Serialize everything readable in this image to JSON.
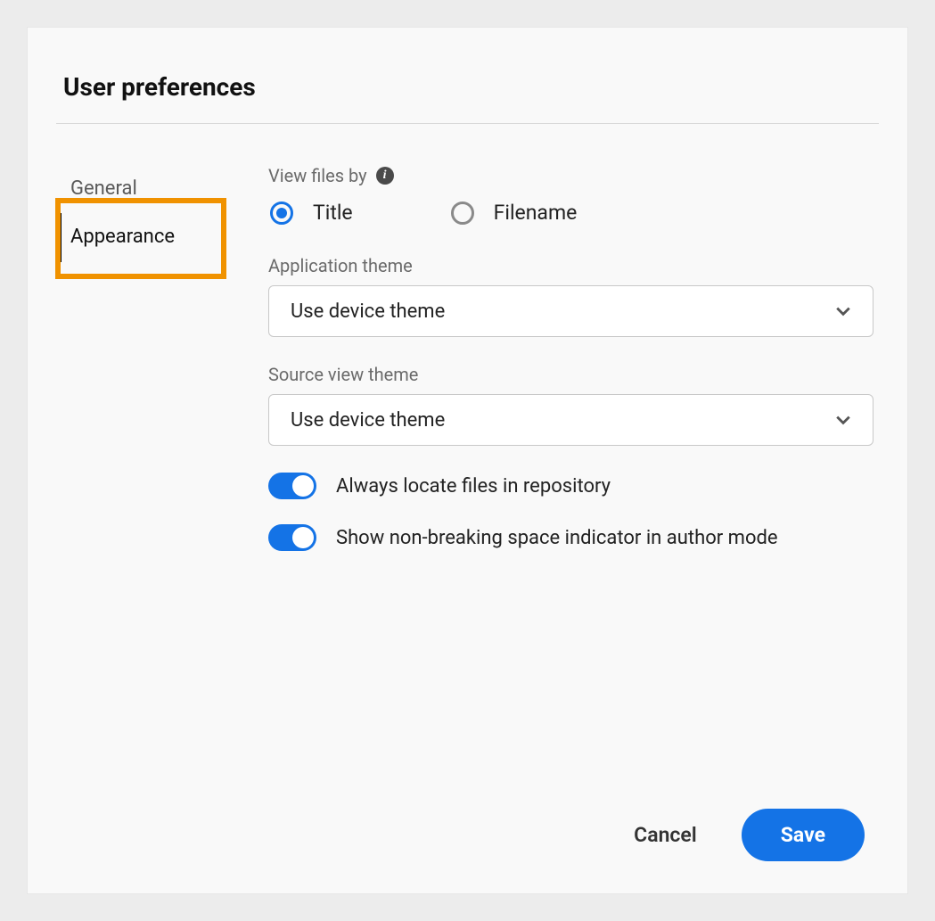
{
  "dialog": {
    "title": "User preferences"
  },
  "sidebar": {
    "tabs": [
      {
        "label": "General",
        "active": false
      },
      {
        "label": "Appearance",
        "active": true
      }
    ]
  },
  "content": {
    "view_files_by": {
      "label": "View files by",
      "options": [
        {
          "label": "Title",
          "selected": true
        },
        {
          "label": "Filename",
          "selected": false
        }
      ]
    },
    "application_theme": {
      "label": "Application theme",
      "value": "Use device theme"
    },
    "source_view_theme": {
      "label": "Source view theme",
      "value": "Use device theme"
    },
    "toggles": [
      {
        "label": "Always locate files in repository",
        "on": true
      },
      {
        "label": "Show non-breaking space indicator in author mode",
        "on": true
      }
    ]
  },
  "footer": {
    "cancel": "Cancel",
    "save": "Save"
  }
}
